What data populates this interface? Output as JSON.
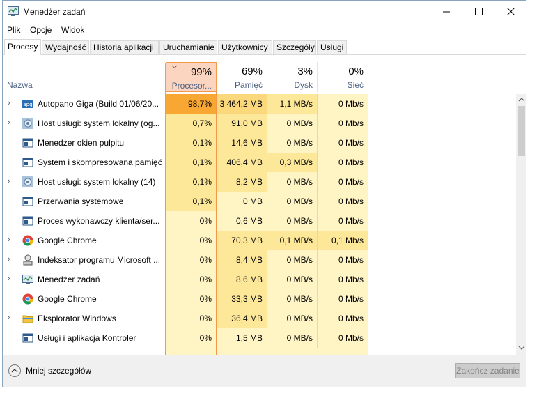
{
  "window": {
    "title": "Menedżer zadań"
  },
  "menu": [
    "Plik",
    "Opcje",
    "Widok"
  ],
  "tabs": [
    "Procesy",
    "Wydajność",
    "Historia aplikacji",
    "Uruchamianie",
    "Użytkownicy",
    "Szczegóły",
    "Usługi"
  ],
  "header": {
    "name": "Nazwa",
    "cpu_pct": "99%",
    "cpu_label": "Procesor...",
    "mem_pct": "69%",
    "mem_label": "Pamięć",
    "disk_pct": "3%",
    "disk_label": "Dysk",
    "net_pct": "0%",
    "net_label": "Sieć"
  },
  "rows": [
    {
      "name": "Autopano Giga (Build 01/06/20...",
      "cpu": "98,7%",
      "mem": "3 464,2 MB",
      "disk": "1,1 MB/s",
      "net": "0 Mb/s"
    },
    {
      "name": "Host usługi: system lokalny (og...",
      "cpu": "0,7%",
      "mem": "91,0 MB",
      "disk": "0 MB/s",
      "net": "0 Mb/s"
    },
    {
      "name": "Menedżer okien pulpitu",
      "cpu": "0,1%",
      "mem": "14,6 MB",
      "disk": "0 MB/s",
      "net": "0 Mb/s"
    },
    {
      "name": "System i skompresowana pamięć",
      "cpu": "0,1%",
      "mem": "406,4 MB",
      "disk": "0,3 MB/s",
      "net": "0 Mb/s"
    },
    {
      "name": "Host usługi: system lokalny (14)",
      "cpu": "0,1%",
      "mem": "8,2 MB",
      "disk": "0 MB/s",
      "net": "0 Mb/s"
    },
    {
      "name": "Przerwania systemowe",
      "cpu": "0,1%",
      "mem": "0 MB",
      "disk": "0 MB/s",
      "net": "0 Mb/s"
    },
    {
      "name": "Proces wykonawczy klienta/ser...",
      "cpu": "0%",
      "mem": "0,6 MB",
      "disk": "0 MB/s",
      "net": "0 Mb/s"
    },
    {
      "name": "Google Chrome",
      "cpu": "0%",
      "mem": "70,3 MB",
      "disk": "0,1 MB/s",
      "net": "0,1 Mb/s"
    },
    {
      "name": "Indeksator programu Microsoft ...",
      "cpu": "0%",
      "mem": "8,4 MB",
      "disk": "0 MB/s",
      "net": "0 Mb/s"
    },
    {
      "name": "Menedżer zadań",
      "cpu": "0%",
      "mem": "8,6 MB",
      "disk": "0 MB/s",
      "net": "0 Mb/s"
    },
    {
      "name": "Google Chrome",
      "cpu": "0%",
      "mem": "33,3 MB",
      "disk": "0 MB/s",
      "net": "0 Mb/s"
    },
    {
      "name": "Eksplorator Windows",
      "cpu": "0%",
      "mem": "36,4 MB",
      "disk": "0 MB/s",
      "net": "0 Mb/s"
    },
    {
      "name": "Usługi i aplikacja Kontroler",
      "cpu": "0%",
      "mem": "1,5 MB",
      "disk": "0 MB/s",
      "net": "0 Mb/s"
    }
  ],
  "footer": {
    "less_details": "Mniej szczegółów",
    "end_task": "Zakończ zadanie"
  },
  "colors": {
    "cpu_high": "#f7a732",
    "cpu_mid": "#fde89a",
    "mem_high": "#fcd87d",
    "cell_base": "#fff4c4",
    "header_active": "#fcd5c0"
  }
}
